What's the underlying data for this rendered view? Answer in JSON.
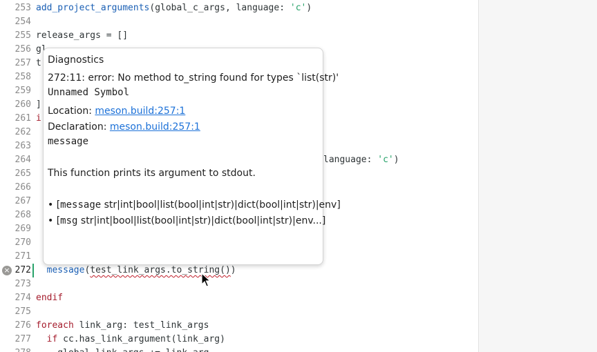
{
  "editor": {
    "lines": [
      {
        "num": "253",
        "segments": [
          [
            "add_project_arguments",
            "fn"
          ],
          [
            "(global_c_args, language: ",
            ""
          ],
          [
            "'c'",
            "str"
          ],
          [
            ")",
            ""
          ]
        ]
      },
      {
        "num": "254",
        "segments": []
      },
      {
        "num": "255",
        "segments": [
          [
            "release_args = []",
            ""
          ]
        ]
      },
      {
        "num": "256",
        "segments": [
          [
            "gl",
            ""
          ]
        ]
      },
      {
        "num": "257",
        "segments": [
          [
            "t",
            ""
          ]
        ]
      },
      {
        "num": "258",
        "segments": []
      },
      {
        "num": "259",
        "segments": []
      },
      {
        "num": "260",
        "segments": [
          [
            "]",
            ""
          ]
        ]
      },
      {
        "num": "261",
        "segments": [
          [
            "i",
            "kw"
          ]
        ]
      },
      {
        "num": "262",
        "segments": []
      },
      {
        "num": "263",
        "segments": []
      },
      {
        "num": "264",
        "segments": [
          [
            "language: ",
            ""
          ],
          [
            "'c'",
            "str"
          ],
          [
            ")",
            ""
          ]
        ]
      },
      {
        "num": "265",
        "segments": []
      },
      {
        "num": "266",
        "segments": []
      },
      {
        "num": "267",
        "segments": []
      },
      {
        "num": "268",
        "segments": []
      },
      {
        "num": "269",
        "segments": []
      },
      {
        "num": "270",
        "segments": []
      },
      {
        "num": "271",
        "segments": []
      },
      {
        "num": "272",
        "segments": [
          [
            "  ",
            ""
          ],
          [
            "message",
            "fn"
          ],
          [
            "(",
            ""
          ],
          [
            "test_link_args.to_string()",
            "err"
          ],
          [
            ")",
            ""
          ]
        ]
      },
      {
        "num": "273",
        "segments": []
      },
      {
        "num": "274",
        "segments": [
          [
            "endif",
            "kw"
          ]
        ]
      },
      {
        "num": "275",
        "segments": []
      },
      {
        "num": "276",
        "segments": [
          [
            "foreach",
            "kw"
          ],
          [
            " link_arg: test_link_args",
            ""
          ]
        ]
      },
      {
        "num": "277",
        "segments": [
          [
            "  ",
            ""
          ],
          [
            "if",
            "kw"
          ],
          [
            " cc.has_link_argument(link_arg)",
            ""
          ]
        ]
      },
      {
        "num": "278",
        "segments": [
          [
            "    global_link_args += link_arg",
            ""
          ]
        ]
      }
    ],
    "error_line_icon": "error-circle-icon"
  },
  "tooltip": {
    "header": "Diagnostics",
    "message": "272:11: error: No method to_string found for types `list(str)'",
    "symbol": "Unnamed Symbol",
    "location_label": "Location: ",
    "location_link": "meson.build:257:1",
    "declaration_label": "Declaration: ",
    "declaration_link": "meson.build:257:1",
    "function_name": "message",
    "description": "This function prints its argument to stdout.",
    "sig1_bullet": "• [",
    "sig1_name": "message",
    "sig1_rest": " str|int|bool|list(bool|int|str)|dict(bool|int|str)|env]",
    "sig2_bullet": "• [",
    "sig2_name": "msg",
    "sig2_rest": " str|int|bool|list(bool|int|str)|dict(bool|int|str)|env...]"
  },
  "colors": {
    "function": "#1a5fb4",
    "keyword": "#a51d2d",
    "string": "#26a269",
    "link": "#1c71d8",
    "error_underline": "#c01c28"
  }
}
